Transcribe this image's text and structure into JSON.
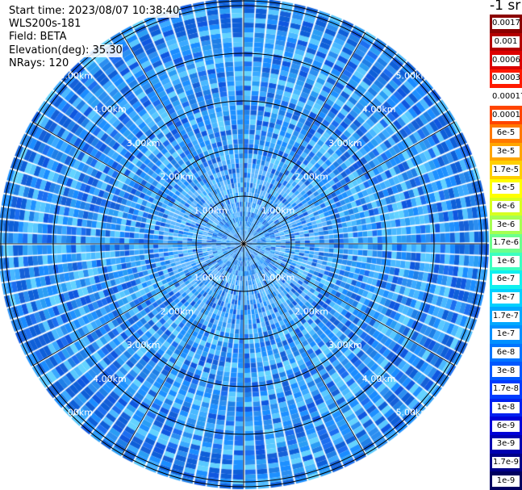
{
  "header": {
    "start_time": "Start time: 2023/08/07 10:38:40",
    "instrument": "WLS200s-181",
    "field": "Field: BETA",
    "elevation": "Elevation(deg): 35.30",
    "nrays": "NRays: 120"
  },
  "colorbar": {
    "unit_label": "-1 sr",
    "labels": [
      "0.0017",
      "0.001",
      "0.0006",
      "0.0003",
      "0.00017",
      "0.0001",
      "6e-5",
      "3e-5",
      "1.7e-5",
      "1e-5",
      "6e-6",
      "3e-6",
      "1.7e-6",
      "1e-6",
      "6e-7",
      "3e-7",
      "1.7e-7",
      "1e-7",
      "6e-8",
      "3e-8",
      "1.7e-8",
      "1e-8",
      "6e-9",
      "3e-9",
      "1.7e-9",
      "1e-9"
    ],
    "colors": [
      "#8b0000",
      "#b40000",
      "#dc0000",
      "#ff1a00",
      "#ffffff",
      "#ff4500",
      "#ff7800",
      "#ffa500",
      "#ffcf00",
      "#ffff00",
      "#d8ff20",
      "#a6ff52",
      "#6cff8c",
      "#3cffc0",
      "#10f0ef",
      "#00d0ff",
      "#00a8ff",
      "#0090ff",
      "#0074ff",
      "#0058ff",
      "#003cff",
      "#0020f0",
      "#0000d8",
      "#0000b0",
      "#000088",
      "#000060"
    ]
  },
  "chart_data": {
    "type": "heatmap",
    "projection": "polar (PPI scan)",
    "field": "BETA",
    "nrays": 120,
    "range_rings_km": [
      1,
      2,
      3,
      4,
      5
    ],
    "range_labels": [
      "1.00km",
      "2.00km",
      "3.00km",
      "4.00km",
      "5.00km"
    ],
    "spoke_angles_deg": [
      0,
      30,
      60,
      90,
      120,
      150,
      180,
      210,
      240,
      270,
      300,
      330
    ],
    "dominant_value_range": [
      "1.7e-8",
      "1e-7"
    ],
    "colorscale": "log"
  }
}
